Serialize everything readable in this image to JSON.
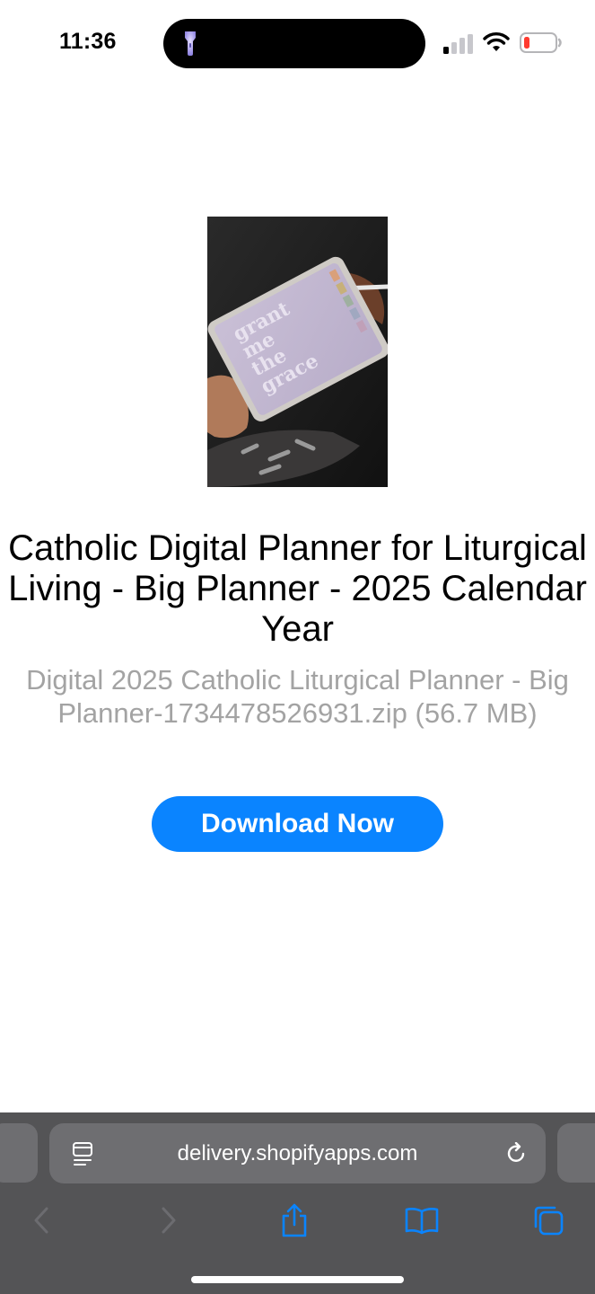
{
  "status_bar": {
    "time": "11:36",
    "icons": [
      "flashlight-icon",
      "cellular-signal-icon",
      "wifi-icon",
      "battery-low-icon"
    ],
    "battery_color": "#ff3b30"
  },
  "product": {
    "image_alt": "product-photo",
    "image_text": "grant me the grace",
    "title": "Catholic Digital Planner for Liturgical Living - Big Planner - 2025 Calendar Year",
    "file_info": "Digital 2025 Catholic Liturgical Planner - Big Planner-1734478526931.zip (56.7 MB)",
    "download_label": "Download Now"
  },
  "browser": {
    "url": "delivery.shopifyapps.com",
    "toolbar": [
      "back-icon",
      "forward-icon",
      "share-icon",
      "bookmarks-icon",
      "tabs-icon"
    ]
  },
  "colors": {
    "accent": "#0a84ff",
    "browser_bar": "#545456",
    "secondary_text": "#a3a3a3"
  }
}
